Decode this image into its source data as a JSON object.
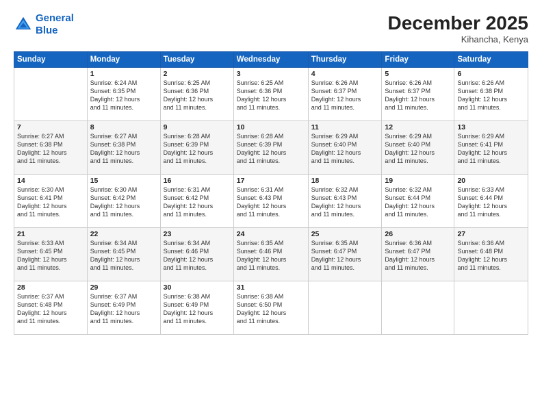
{
  "logo": {
    "line1": "General",
    "line2": "Blue"
  },
  "header": {
    "month": "December 2025",
    "location": "Kihancha, Kenya"
  },
  "days_of_week": [
    "Sunday",
    "Monday",
    "Tuesday",
    "Wednesday",
    "Thursday",
    "Friday",
    "Saturday"
  ],
  "weeks": [
    [
      {
        "day": "",
        "info": ""
      },
      {
        "day": "1",
        "info": "Sunrise: 6:24 AM\nSunset: 6:35 PM\nDaylight: 12 hours\nand 11 minutes."
      },
      {
        "day": "2",
        "info": "Sunrise: 6:25 AM\nSunset: 6:36 PM\nDaylight: 12 hours\nand 11 minutes."
      },
      {
        "day": "3",
        "info": "Sunrise: 6:25 AM\nSunset: 6:36 PM\nDaylight: 12 hours\nand 11 minutes."
      },
      {
        "day": "4",
        "info": "Sunrise: 6:26 AM\nSunset: 6:37 PM\nDaylight: 12 hours\nand 11 minutes."
      },
      {
        "day": "5",
        "info": "Sunrise: 6:26 AM\nSunset: 6:37 PM\nDaylight: 12 hours\nand 11 minutes."
      },
      {
        "day": "6",
        "info": "Sunrise: 6:26 AM\nSunset: 6:38 PM\nDaylight: 12 hours\nand 11 minutes."
      }
    ],
    [
      {
        "day": "7",
        "info": "Sunrise: 6:27 AM\nSunset: 6:38 PM\nDaylight: 12 hours\nand 11 minutes."
      },
      {
        "day": "8",
        "info": "Sunrise: 6:27 AM\nSunset: 6:38 PM\nDaylight: 12 hours\nand 11 minutes."
      },
      {
        "day": "9",
        "info": "Sunrise: 6:28 AM\nSunset: 6:39 PM\nDaylight: 12 hours\nand 11 minutes."
      },
      {
        "day": "10",
        "info": "Sunrise: 6:28 AM\nSunset: 6:39 PM\nDaylight: 12 hours\nand 11 minutes."
      },
      {
        "day": "11",
        "info": "Sunrise: 6:29 AM\nSunset: 6:40 PM\nDaylight: 12 hours\nand 11 minutes."
      },
      {
        "day": "12",
        "info": "Sunrise: 6:29 AM\nSunset: 6:40 PM\nDaylight: 12 hours\nand 11 minutes."
      },
      {
        "day": "13",
        "info": "Sunrise: 6:29 AM\nSunset: 6:41 PM\nDaylight: 12 hours\nand 11 minutes."
      }
    ],
    [
      {
        "day": "14",
        "info": "Sunrise: 6:30 AM\nSunset: 6:41 PM\nDaylight: 12 hours\nand 11 minutes."
      },
      {
        "day": "15",
        "info": "Sunrise: 6:30 AM\nSunset: 6:42 PM\nDaylight: 12 hours\nand 11 minutes."
      },
      {
        "day": "16",
        "info": "Sunrise: 6:31 AM\nSunset: 6:42 PM\nDaylight: 12 hours\nand 11 minutes."
      },
      {
        "day": "17",
        "info": "Sunrise: 6:31 AM\nSunset: 6:43 PM\nDaylight: 12 hours\nand 11 minutes."
      },
      {
        "day": "18",
        "info": "Sunrise: 6:32 AM\nSunset: 6:43 PM\nDaylight: 12 hours\nand 11 minutes."
      },
      {
        "day": "19",
        "info": "Sunrise: 6:32 AM\nSunset: 6:44 PM\nDaylight: 12 hours\nand 11 minutes."
      },
      {
        "day": "20",
        "info": "Sunrise: 6:33 AM\nSunset: 6:44 PM\nDaylight: 12 hours\nand 11 minutes."
      }
    ],
    [
      {
        "day": "21",
        "info": "Sunrise: 6:33 AM\nSunset: 6:45 PM\nDaylight: 12 hours\nand 11 minutes."
      },
      {
        "day": "22",
        "info": "Sunrise: 6:34 AM\nSunset: 6:45 PM\nDaylight: 12 hours\nand 11 minutes."
      },
      {
        "day": "23",
        "info": "Sunrise: 6:34 AM\nSunset: 6:46 PM\nDaylight: 12 hours\nand 11 minutes."
      },
      {
        "day": "24",
        "info": "Sunrise: 6:35 AM\nSunset: 6:46 PM\nDaylight: 12 hours\nand 11 minutes."
      },
      {
        "day": "25",
        "info": "Sunrise: 6:35 AM\nSunset: 6:47 PM\nDaylight: 12 hours\nand 11 minutes."
      },
      {
        "day": "26",
        "info": "Sunrise: 6:36 AM\nSunset: 6:47 PM\nDaylight: 12 hours\nand 11 minutes."
      },
      {
        "day": "27",
        "info": "Sunrise: 6:36 AM\nSunset: 6:48 PM\nDaylight: 12 hours\nand 11 minutes."
      }
    ],
    [
      {
        "day": "28",
        "info": "Sunrise: 6:37 AM\nSunset: 6:48 PM\nDaylight: 12 hours\nand 11 minutes."
      },
      {
        "day": "29",
        "info": "Sunrise: 6:37 AM\nSunset: 6:49 PM\nDaylight: 12 hours\nand 11 minutes."
      },
      {
        "day": "30",
        "info": "Sunrise: 6:38 AM\nSunset: 6:49 PM\nDaylight: 12 hours\nand 11 minutes."
      },
      {
        "day": "31",
        "info": "Sunrise: 6:38 AM\nSunset: 6:50 PM\nDaylight: 12 hours\nand 11 minutes."
      },
      {
        "day": "",
        "info": ""
      },
      {
        "day": "",
        "info": ""
      },
      {
        "day": "",
        "info": ""
      }
    ]
  ]
}
